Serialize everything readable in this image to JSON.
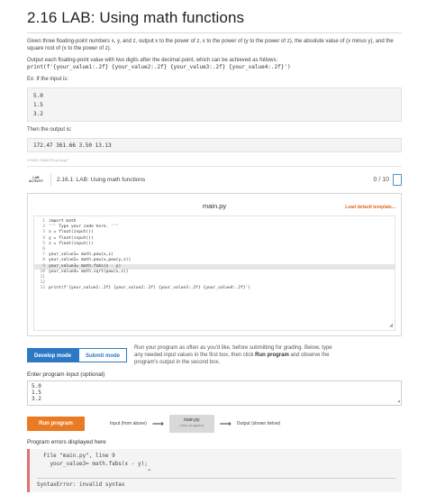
{
  "header": {
    "title": "2.16 LAB: Using math functions"
  },
  "instructions": {
    "paragraph1": "Given three floating-point numbers x, y, and z, output x to the power of z, x to the power of (y to the power of z), the absolute value of (x minus y), and the square root of (x to the power of z).",
    "paragraph2": "Output each floating-point value with two digits after the decimal point, which can be achieved as follows:",
    "format_code": "print(f'{your_value1:.2f} {your_value2:.2f} {your_value3:.2f} {your_value4:.2f}')",
    "example_intro": "Ex: If the input is:",
    "example_input": [
      "5.0",
      "1.5",
      "3.2"
    ],
    "output_intro": "Then the output is:",
    "example_output": "172.47 361.66 3.50 13.13",
    "feedback_tag": "476802.3085276.qx3zqy7"
  },
  "lab": {
    "badge_line1": "LAB",
    "badge_line2": "ACTIVITY",
    "name": "2.16.1: LAB: Using math functions",
    "score": "0 / 10"
  },
  "editor": {
    "file_name": "main.py",
    "load_template": "Load default template...",
    "line_numbers": [
      "1",
      "2",
      "3",
      "4",
      "5",
      "6",
      "7",
      "8",
      "9",
      "10",
      "11",
      "12",
      "13"
    ],
    "lines": [
      "import math",
      "''' Type your code here. '''",
      "x = float(input())",
      "y = float(input())",
      "z = float(input())",
      "",
      "your_value1= math.pow(x,z)",
      "your_value2= math.pow(x,pow(y,z))",
      "your_value3= math.fabs(x - y)",
      "your_value4= math.sqrt(pow(x,z))",
      "",
      "",
      "print(f'{your_value1:.2f} {your_value2:.2f} {your_value3:.2f} {your_value4:.2f}')"
    ],
    "highlighted_line": 9
  },
  "modes": {
    "develop_label": "Develop mode",
    "submit_label": "Submit mode",
    "desc_prefix": "Run your program as often as you'd like, before submitting for grading. Below, type any needed input values in the first box, then click ",
    "desc_bold": "Run program",
    "desc_suffix": " and observe the program's output in the second box."
  },
  "program_input": {
    "label": "Enter program input (optional)",
    "lines": [
      "5.0",
      "1.5",
      "3.2"
    ]
  },
  "run": {
    "run_label": "Run program",
    "input_from": "Input (from above)",
    "box_line1": "main.py",
    "box_line2": "(Your program)",
    "output_to": "Output (shown below)"
  },
  "errors": {
    "label": "Program errors displayed here",
    "lines": [
      "  File \"main.py\", line 9",
      "    your_value3= math.fabs(x - y);",
      "                                  ^"
    ],
    "message": "SyntaxError: invalid syntax"
  }
}
